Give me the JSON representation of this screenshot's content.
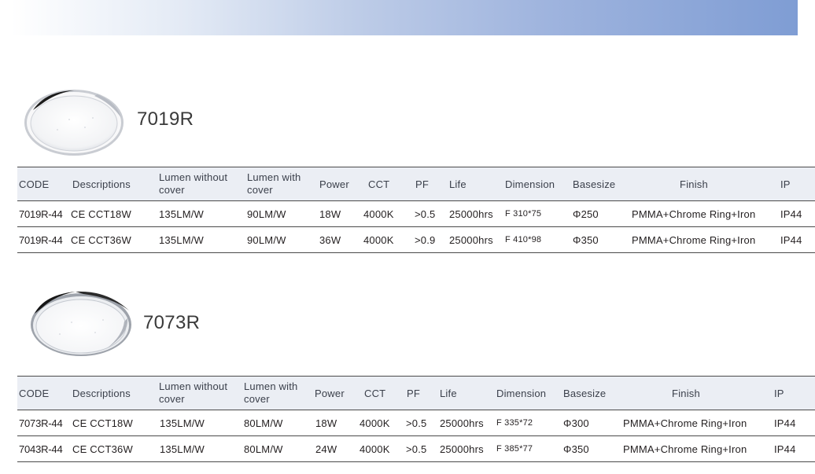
{
  "headers": {
    "code": "CODE",
    "descriptions": "Descriptions",
    "lumen_without": "Lumen without cover",
    "lumen_with": "Lumen with cover",
    "power": "Power",
    "cct": "CCT",
    "pf": "PF",
    "life": "Life",
    "dimension": "Dimension",
    "base_size": "Basesize",
    "finish": "Finish",
    "ip": "IP"
  },
  "products": [
    {
      "title": "7019R",
      "rows": [
        {
          "code": "7019R-44",
          "desc": "CE CCT18W",
          "lumen_without": "135LM/W",
          "lumen_with": "90LM/W",
          "power": "18W",
          "cct": "4000K",
          "pf": ">0.5",
          "life": "25000hrs",
          "dimension": "F 310*75",
          "base": "Φ250",
          "finish": "PMMA+Chrome  Ring+Iron",
          "ip": "IP44"
        },
        {
          "code": "7019R-44",
          "desc": "CE CCT36W",
          "lumen_without": "135LM/W",
          "lumen_with": "90LM/W",
          "power": "36W",
          "cct": "4000K",
          "pf": ">0.9",
          "life": "25000hrs",
          "dimension": "F 410*98",
          "base": "Φ350",
          "finish": "PMMA+Chrome  Ring+Iron",
          "ip": "IP44"
        }
      ]
    },
    {
      "title": "7073R",
      "rows": [
        {
          "code": "7073R-44",
          "desc": "CE CCT18W",
          "lumen_without": "135LM/W",
          "lumen_with": "80LM/W",
          "power": "18W",
          "cct": "4000K",
          "pf": ">0.5",
          "life": "25000hrs",
          "dimension": "F 335*72",
          "base": "Φ300",
          "finish": "PMMA+Chrome  Ring+Iron",
          "ip": "IP44"
        },
        {
          "code": "7043R-44",
          "desc": "CE CCT36W",
          "lumen_without": "135LM/W",
          "lumen_with": "80LM/W",
          "power": "24W",
          "cct": "4000K",
          "pf": ">0.5",
          "life": "25000hrs",
          "dimension": "F 385*77",
          "base": "Φ350",
          "finish": "PMMA+Chrome  Ring+Iron",
          "ip": "IP44"
        }
      ]
    }
  ]
}
